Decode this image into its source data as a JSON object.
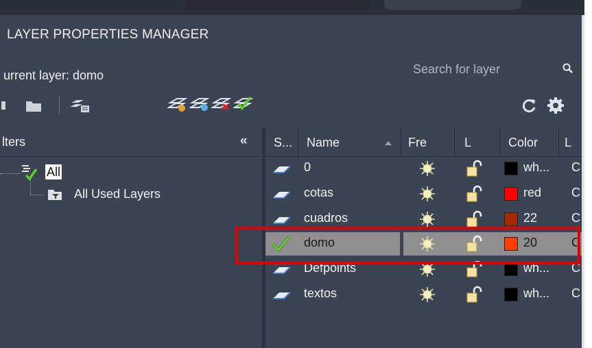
{
  "panel": {
    "title": "LAYER PROPERTIES MANAGER",
    "current_layer": "urrent layer: domo",
    "search_placeholder": "Search for layer"
  },
  "filters": {
    "header": "lters",
    "collapse_glyph": "«",
    "tree": [
      {
        "label": "All",
        "selected": true
      },
      {
        "label": "All Used Layers",
        "selected": false
      }
    ]
  },
  "grid": {
    "columns": [
      "S...",
      "Name",
      "Fre",
      "L",
      "Color",
      "L"
    ],
    "rows": [
      {
        "name": "0",
        "status": "layer-icon",
        "color_label": "wh...",
        "color": "#000000",
        "linetype": "C",
        "current": false
      },
      {
        "name": "cotas",
        "status": "layer-icon",
        "color_label": "red",
        "color": "#ff0000",
        "linetype": "C",
        "current": false
      },
      {
        "name": "cuadros",
        "status": "layer-icon",
        "color_label": "22",
        "color": "#a52a00",
        "linetype": "C",
        "current": false
      },
      {
        "name": "domo",
        "status": "current-check-icon",
        "color_label": "20",
        "color": "#ff3f00",
        "linetype": "C",
        "current": true
      },
      {
        "name": "Defpoints",
        "status": "layer-icon",
        "color_label": "wh...",
        "color": "#000000",
        "linetype": "C",
        "current": false
      },
      {
        "name": "textos",
        "status": "layer-icon",
        "color_label": "wh...",
        "color": "#000000",
        "linetype": "C",
        "current": false
      }
    ]
  },
  "colors": {
    "panel_bg": "#3b4453",
    "selection": "#8f8f8f",
    "highlight_box": "#e00000"
  }
}
